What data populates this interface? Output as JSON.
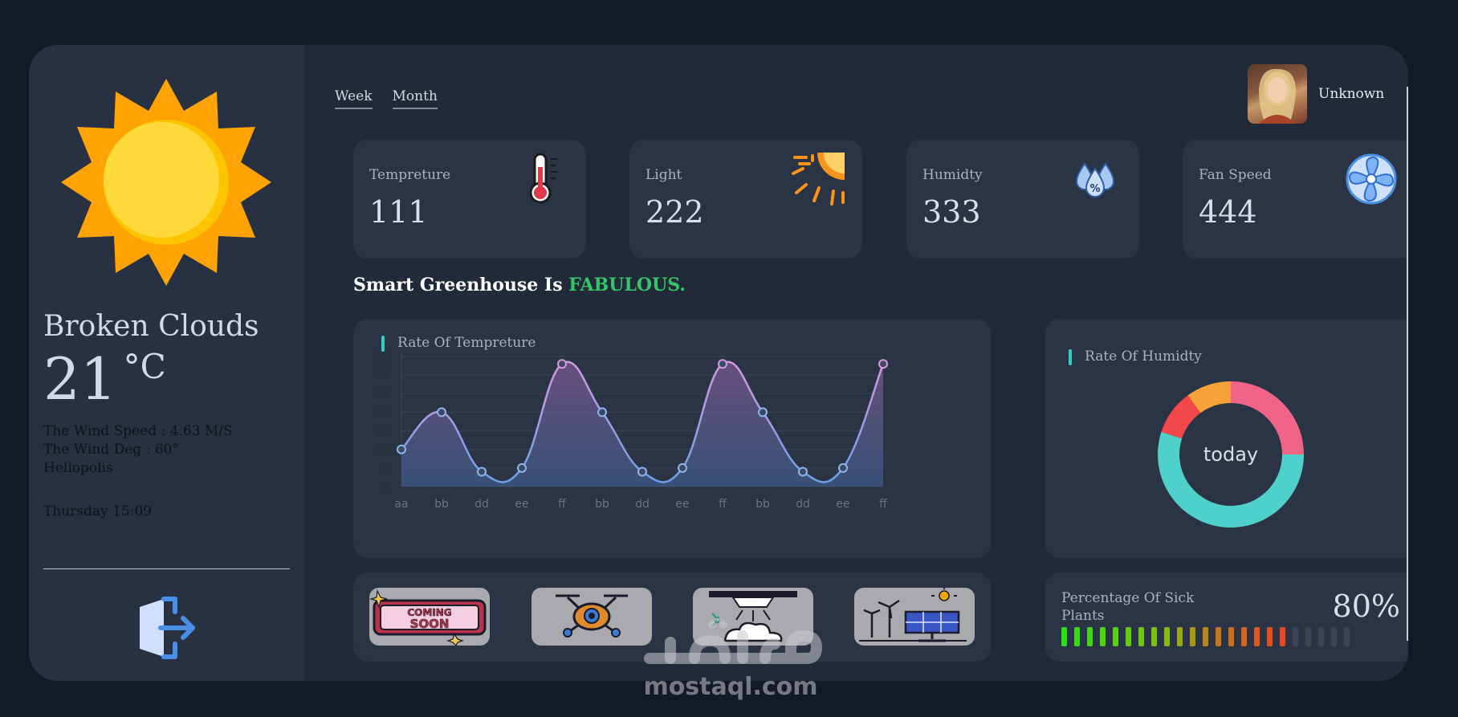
{
  "sidebar": {
    "condition": "Broken Clouds",
    "temperature": "21",
    "temperature_unit": "°C",
    "wind_speed": "The Wind Speed : 4.63 M/S",
    "wind_deg": "The Wind Deg : 60°",
    "location": "Heliopolis",
    "datetime": "Thursday 15:09",
    "weather_icon": "sun-icon",
    "logout_icon": "logout-icon"
  },
  "header": {
    "tabs": [
      {
        "label": "Week"
      },
      {
        "label": "Month"
      }
    ],
    "user": {
      "name": "Unknown"
    }
  },
  "cards": [
    {
      "label": "Tempreture",
      "value": "111",
      "icon": "thermometer-icon"
    },
    {
      "label": "Light",
      "value": "222",
      "icon": "sun-rays-icon"
    },
    {
      "label": "Humidty",
      "value": "333",
      "icon": "humidity-drop-icon"
    },
    {
      "label": "Fan Speed",
      "value": "444",
      "icon": "fan-icon"
    }
  ],
  "status": {
    "prefix": "Smart Greenhouse Is",
    "word": "FABULOUS.",
    "word_color": "#35c46a"
  },
  "temperature_panel": {
    "title": "Rate Of Tempreture"
  },
  "humidity_panel": {
    "title": "Rate Of Humidty",
    "center_label": "today"
  },
  "apps": [
    {
      "icon": "coming-soon-icon"
    },
    {
      "icon": "drone-icon"
    },
    {
      "icon": "irrigation-sprinkler-icon"
    },
    {
      "icon": "solar-wind-energy-icon"
    }
  ],
  "sick_plants": {
    "label": "Percentage Of Sick Plants",
    "value": "80%",
    "fraction": 0.8
  },
  "watermark": {
    "text": "mostaql.com"
  },
  "chart_data": [
    {
      "type": "area",
      "title": "Rate Of Tempreture",
      "categories": [
        "aa",
        "bb",
        "dd",
        "ee",
        "ff",
        "bb",
        "dd",
        "ee",
        "ff",
        "bb",
        "dd",
        "ee",
        "ff"
      ],
      "values": [
        10,
        20,
        4,
        5,
        33,
        20,
        4,
        5,
        33,
        20,
        4,
        5,
        33
      ],
      "ylim": [
        0,
        35
      ],
      "yticks": [
        0,
        5,
        10,
        15,
        20,
        25,
        30,
        35
      ],
      "grid": true
    },
    {
      "type": "pie",
      "title": "Rate Of Humidty",
      "donut": true,
      "center_label": "today",
      "slices": [
        {
          "value": 25,
          "color": "#f0648a"
        },
        {
          "value": 55,
          "color": "#4fd0cb"
        },
        {
          "value": 10,
          "color": "#f4474a"
        },
        {
          "value": 10,
          "color": "#f7a13b"
        }
      ]
    }
  ]
}
